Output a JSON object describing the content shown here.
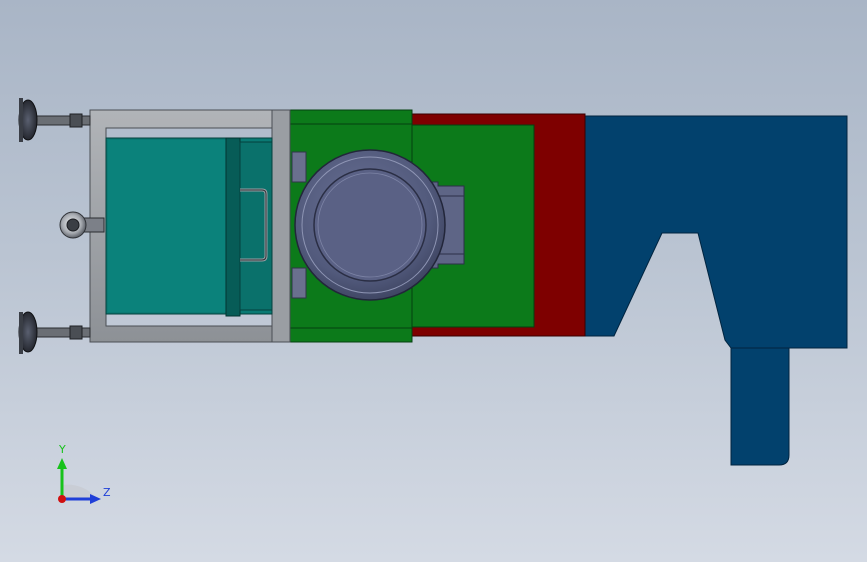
{
  "viewport": {
    "background_top": "#a9b5c6",
    "background_bottom": "#d4dae4"
  },
  "model": {
    "parts": [
      {
        "name": "blue-housing",
        "color": "#02416d"
      },
      {
        "name": "red-plate",
        "color": "#7e0000"
      },
      {
        "name": "green-plate",
        "color": "#0c7a1a"
      },
      {
        "name": "gray-frame",
        "color": "#9fa3a8"
      },
      {
        "name": "teal-box",
        "color": "#0a7a74"
      },
      {
        "name": "motor-disc",
        "color": "#5a6185"
      }
    ]
  },
  "triad": {
    "y_label": "Y",
    "z_label": "Z",
    "y_color": "#17c21b",
    "z_color": "#1f3fd8",
    "x_color": "#d01010"
  }
}
